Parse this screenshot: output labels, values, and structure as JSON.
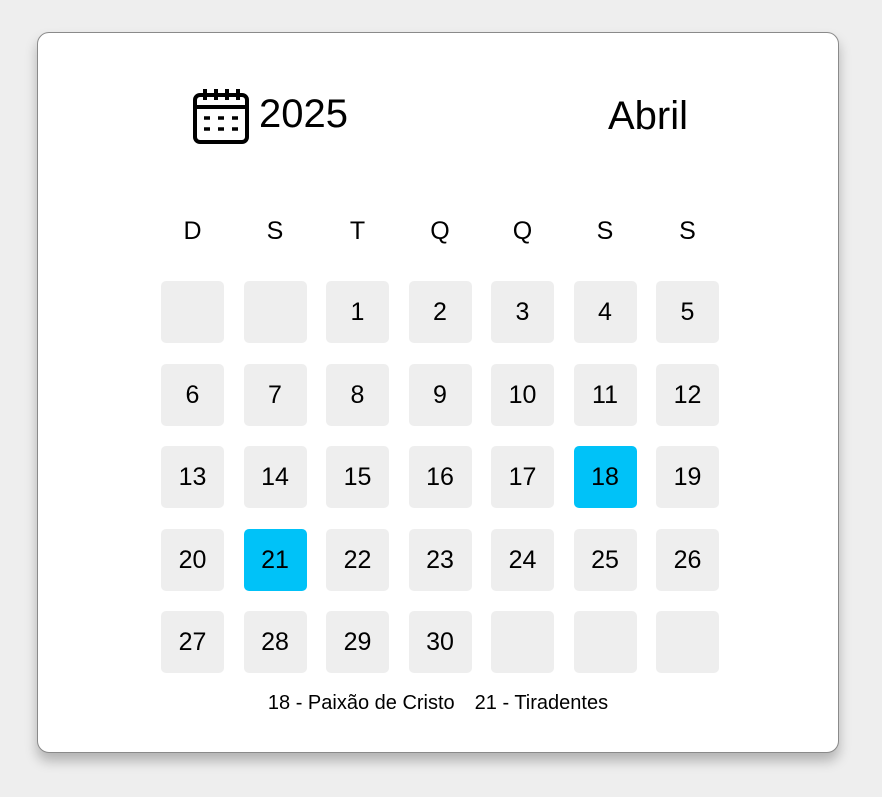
{
  "header": {
    "year": "2025",
    "month": "Abril",
    "icon": "calendar-icon"
  },
  "weekdays": [
    "D",
    "S",
    "T",
    "Q",
    "Q",
    "S",
    "S"
  ],
  "weeks": [
    [
      "",
      "",
      "1",
      "2",
      "3",
      "4",
      "5"
    ],
    [
      "6",
      "7",
      "8",
      "9",
      "10",
      "11",
      "12"
    ],
    [
      "13",
      "14",
      "15",
      "16",
      "17",
      "18",
      "19"
    ],
    [
      "20",
      "21",
      "22",
      "23",
      "24",
      "25",
      "26"
    ],
    [
      "27",
      "28",
      "29",
      "30",
      "",
      "",
      ""
    ]
  ],
  "holidays": [
    "18",
    "21"
  ],
  "legend": [
    "18 - Paixão de Cristo",
    "21 - Tiradentes"
  ],
  "colors": {
    "holiday": "#00c2f8",
    "cell": "#eeeeee"
  }
}
